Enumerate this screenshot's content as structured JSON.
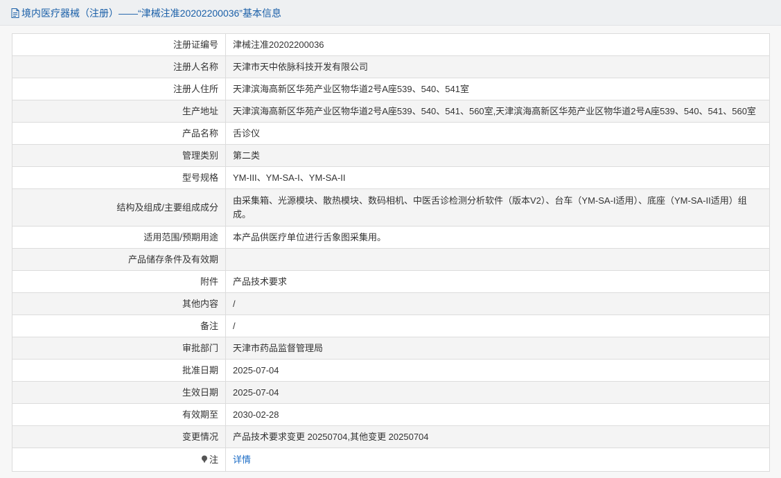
{
  "header": {
    "title": "境内医疗器械（注册）——“津械注准20202200036”基本信息"
  },
  "rows": [
    {
      "label": "注册证编号",
      "value": "津械注准20202200036"
    },
    {
      "label": "注册人名称",
      "value": "天津市天中依脉科技开发有限公司"
    },
    {
      "label": "注册人住所",
      "value": "天津滨海高新区华苑产业区物华道2号A座539、540、541室"
    },
    {
      "label": "生产地址",
      "value": "天津滨海高新区华苑产业区物华道2号A座539、540、541、560室,天津滨海高新区华苑产业区物华道2号A座539、540、541、560室"
    },
    {
      "label": "产品名称",
      "value": "舌诊仪"
    },
    {
      "label": "管理类别",
      "value": "第二类"
    },
    {
      "label": "型号规格",
      "value": "YM-III、YM-SA-I、YM-SA-II"
    },
    {
      "label": "结构及组成/主要组成成分",
      "value": "由采集箱、光源模块、散热模块、数码相机、中医舌诊检测分析软件（版本V2）、台车（YM-SA-I适用）、底座（YM-SA-II适用）组成。"
    },
    {
      "label": "适用范围/预期用途",
      "value": "本产品供医疗单位进行舌象图采集用。"
    },
    {
      "label": "产品储存条件及有效期",
      "value": ""
    },
    {
      "label": "附件",
      "value": "产品技术要求"
    },
    {
      "label": "其他内容",
      "value": "/"
    },
    {
      "label": "备注",
      "value": "/"
    },
    {
      "label": "审批部门",
      "value": "天津市药品监督管理局"
    },
    {
      "label": "批准日期",
      "value": "2025-07-04"
    },
    {
      "label": "生效日期",
      "value": "2025-07-04"
    },
    {
      "label": "有效期至",
      "value": "2030-02-28"
    },
    {
      "label": "变更情况",
      "value": "产品技术要求变更 20250704,其他变更 20250704"
    }
  ],
  "note_row": {
    "label": "注",
    "icon": "note-icon",
    "link": "详情"
  },
  "colors": {
    "header_text": "#1a5fa8",
    "link": "#1a6bc5",
    "row_alt": "#f4f4f4",
    "border": "#dcdcdc"
  }
}
